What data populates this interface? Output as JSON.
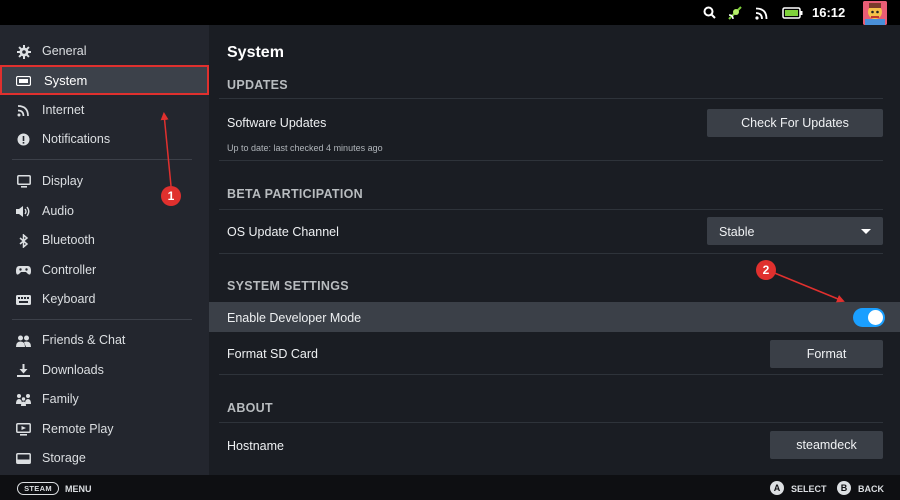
{
  "status_bar": {
    "icons": [
      "search-icon",
      "cast-icon",
      "wifi-icon",
      "battery-icon"
    ],
    "time": "16:12",
    "avatar": "user-avatar"
  },
  "sidebar": {
    "items": [
      {
        "label": "General",
        "icon": "gear-icon"
      },
      {
        "label": "System",
        "icon": "system-icon",
        "active": true
      },
      {
        "label": "Internet",
        "icon": "wifi-icon"
      },
      {
        "label": "Notifications",
        "icon": "info-icon"
      },
      {
        "label": "Display",
        "icon": "monitor-icon"
      },
      {
        "label": "Audio",
        "icon": "speaker-icon"
      },
      {
        "label": "Bluetooth",
        "icon": "bluetooth-icon"
      },
      {
        "label": "Controller",
        "icon": "gamepad-icon"
      },
      {
        "label": "Keyboard",
        "icon": "keyboard-icon"
      },
      {
        "label": "Friends & Chat",
        "icon": "friends-icon"
      },
      {
        "label": "Downloads",
        "icon": "download-icon"
      },
      {
        "label": "Family",
        "icon": "family-icon"
      },
      {
        "label": "Remote Play",
        "icon": "remote-play-icon"
      },
      {
        "label": "Storage",
        "icon": "storage-icon"
      }
    ]
  },
  "main": {
    "title": "System",
    "updates": {
      "header": "UPDATES",
      "software_updates_label": "Software Updates",
      "status": "Up to date: last checked 4 minutes ago",
      "check_button": "Check For Updates"
    },
    "beta": {
      "header": "BETA PARTICIPATION",
      "channel_label": "OS Update Channel",
      "channel_value": "Stable"
    },
    "system_settings": {
      "header": "SYSTEM SETTINGS",
      "developer_mode_label": "Enable Developer Mode",
      "developer_mode_on": true,
      "format_sd_label": "Format SD Card",
      "format_button": "Format"
    },
    "about": {
      "header": "ABOUT",
      "hostname_label": "Hostname",
      "hostname_value": "steamdeck"
    }
  },
  "bottom_bar": {
    "steam_label": "STEAM",
    "menu_label": "MENU",
    "a_button": "A",
    "select_label": "SELECT",
    "b_button": "B",
    "back_label": "BACK"
  },
  "annotations": {
    "badge_1": "1",
    "badge_2": "2",
    "color": "#e0302e"
  },
  "colors": {
    "accent": "#1a9fff",
    "sidebar_bg": "#23262e",
    "main_bg": "#1a1d23",
    "annotation_red": "#e0302e"
  }
}
